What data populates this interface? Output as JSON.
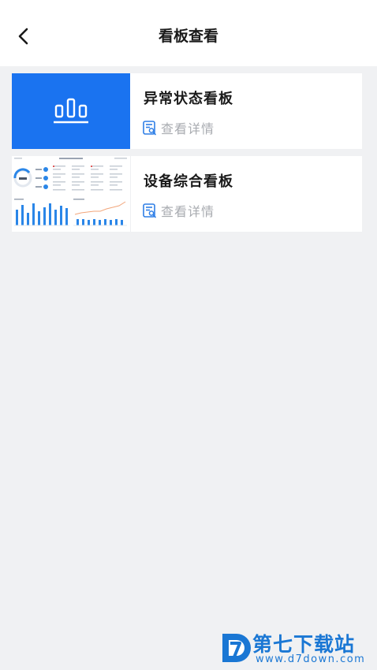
{
  "header": {
    "title": "看板查看",
    "back_icon": "chevron-left-icon"
  },
  "boards": [
    {
      "title": "异常状态看板",
      "link_label": "查看详情",
      "thumbnail": "bar-chart-icon",
      "thumbnail_color": "#1a73f0"
    },
    {
      "title": "设备综合看板",
      "link_label": "查看详情",
      "thumbnail": "dashboard-preview"
    }
  ],
  "link_icon": "document-search-icon",
  "watermark": {
    "title": "第七下载站",
    "url": "www.d7down.com"
  }
}
